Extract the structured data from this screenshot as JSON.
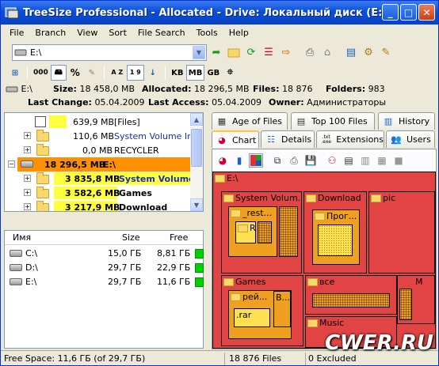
{
  "window": {
    "title": "TreeSize Professional - Allocated - Drive: Локальный диск (E:)",
    "buttons": {
      "minimize": "_",
      "maximize": "□",
      "close": "✕"
    }
  },
  "menu": [
    "File",
    "Branch",
    "View",
    "Sort",
    "File Search",
    "Tools",
    "Help"
  ],
  "toolbar": {
    "path_value": "E:\\",
    "unit_buttons": [
      "KB",
      "MB",
      "GB"
    ],
    "active_unit": "MB",
    "percent_label": "%",
    "count_label": "000",
    "sort_az": "A Z",
    "sort_19": "1 9"
  },
  "drive_info": {
    "drive": "E:\\",
    "size_label": "Size:",
    "size_value": "18 458,0 MB",
    "allocated_label": "Allocated:",
    "allocated_value": "18 296,5 MB",
    "files_label": "Files:",
    "files_value": "18 876",
    "folders_label": "Folders:",
    "folders_value": "983",
    "last_change_label": "Last Change:",
    "last_change_value": "05.04.2009",
    "last_access_label": "Last Access:",
    "last_access_value": "05.04.2009",
    "owner_label": "Owner:",
    "owner_value": "Администраторы"
  },
  "tree": [
    {
      "size": "639,9 MB",
      "name": "[Files]",
      "bold": false,
      "blue": false
    },
    {
      "size": "110,6 MB",
      "name": "System Volume Infor",
      "bold": false,
      "blue": true
    },
    {
      "size": "0,0 MB",
      "name": "RECYCLER",
      "bold": false,
      "blue": false
    },
    {
      "size": "18 296,5 MB",
      "name": "E:\\",
      "bold": true,
      "blue": false
    },
    {
      "size": "3 835,8 MB",
      "name": "System Volume I",
      "bold": true,
      "blue": true
    },
    {
      "size": "3 582,6 MB",
      "name": "Games",
      "bold": true,
      "blue": false
    },
    {
      "size": "3 217,9 MB",
      "name": "Download",
      "bold": true,
      "blue": false
    }
  ],
  "drives": {
    "headers": {
      "name": "Имя",
      "size": "Size",
      "free": "Free"
    },
    "rows": [
      {
        "name": "C:\\",
        "size": "15,0 ГБ",
        "free": "8,81 ГБ"
      },
      {
        "name": "D:\\",
        "size": "29,7 ГБ",
        "free": "22,9 ГБ"
      },
      {
        "name": "E:\\",
        "size": "29,7 ГБ",
        "free": "11,6 ГБ"
      }
    ]
  },
  "tabs_row1": [
    {
      "label": "Age of Files",
      "icon": "calendar-icon"
    },
    {
      "label": "Top 100 Files",
      "icon": "list-icon"
    },
    {
      "label": "History",
      "icon": "history-icon"
    }
  ],
  "tabs_row2": [
    {
      "label": "Chart",
      "icon": "pie-chart-icon",
      "active": true
    },
    {
      "label": "Details",
      "icon": "details-icon"
    },
    {
      "label": "Extensions",
      "icon": "extensions-icon",
      "prefix": ".txt .exe"
    },
    {
      "label": "Users",
      "icon": "users-icon"
    }
  ],
  "treemap": {
    "root": "E:\\",
    "blocks": {
      "system_volume": "System Volum...",
      "rest": "_rest...",
      "r": "R",
      "download": "Download",
      "prog": "Прог...",
      "pic": "pic",
      "games": "Games",
      "rei": "рей...",
      "b": "B...",
      "rar": ".rar",
      "vse": "все",
      "m": "M",
      "music": "Music"
    },
    "colors": {
      "background": "#e24444",
      "orange": "#f0a020",
      "yellow": "#ffe050"
    }
  },
  "status": {
    "free_space": "Free Space: 11,6 ГБ  (of 29,7 ГБ)",
    "files": "18 876  Files",
    "excluded": "0 Excluded"
  },
  "watermark": "CWER.RU"
}
